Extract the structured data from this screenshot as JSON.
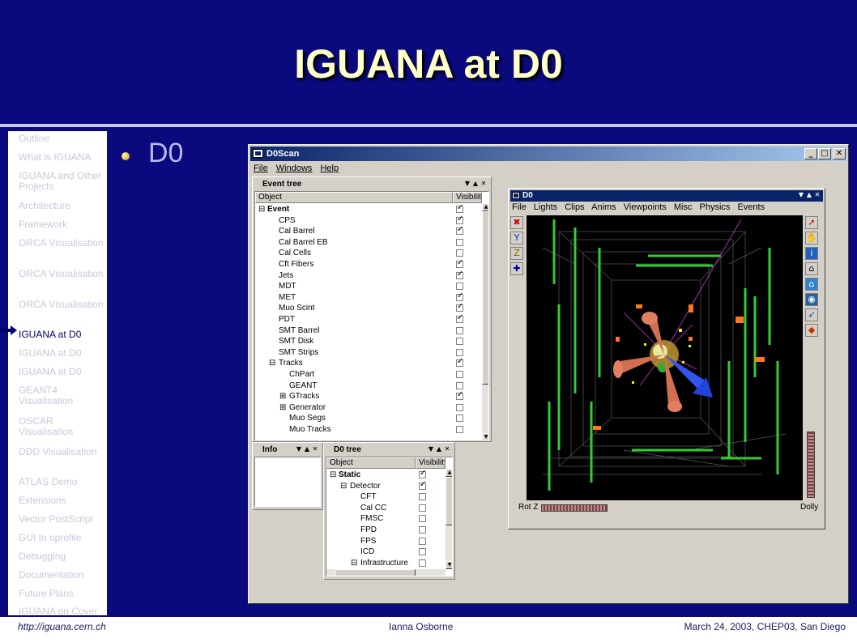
{
  "slide": {
    "title": "IGUANA at D0",
    "bullet": "D0"
  },
  "nav": {
    "items": [
      {
        "label": "Outline"
      },
      {
        "label": "What is IGUANA"
      },
      {
        "label": "IGUANA and Other Projects"
      },
      {
        "label": "Architecture"
      },
      {
        "label": "Framework"
      },
      {
        "label": "ORCA Visualisation"
      },
      {
        "label": "ORCA Visualisation"
      },
      {
        "label": "ORCA Visualisation"
      },
      {
        "label": "IGUANA at D0"
      },
      {
        "label": "IGUANA at D0"
      },
      {
        "label": "IGUANA at D0"
      },
      {
        "label": "GEANT4 Visualisation"
      },
      {
        "label": "OSCAR Visualisation"
      },
      {
        "label": "DDD Visualisation"
      },
      {
        "label": "ATLAS Demo"
      },
      {
        "label": "Extensions"
      },
      {
        "label": "Vector PostScript"
      },
      {
        "label": "GUI to oprofile"
      },
      {
        "label": "Debugging"
      },
      {
        "label": "Documentation"
      },
      {
        "label": "Future Plans"
      },
      {
        "label": "IGUANA on Cover"
      }
    ],
    "active_index": 8
  },
  "footer": {
    "url": "http://iguana.cern.ch",
    "author": "Ianna Osborne",
    "date": "March 24, 2003, CHEP03, San Diego"
  },
  "d0scan": {
    "title": "D0Scan",
    "menu": [
      "File",
      "Windows",
      "Help"
    ],
    "buttons": {
      "minimize": "_",
      "maximize": "□",
      "close": "✕"
    }
  },
  "event_tree": {
    "title": "Event tree",
    "col_object": "Object",
    "col_visibility": "Visibility",
    "rows": [
      {
        "label": "Event",
        "depth": 0,
        "expander": "⊟",
        "bold": true,
        "checked": true
      },
      {
        "label": "CPS",
        "depth": 1,
        "expander": "",
        "bold": false,
        "checked": true
      },
      {
        "label": "Cal Barrel",
        "depth": 1,
        "expander": "",
        "bold": false,
        "checked": true
      },
      {
        "label": "Cal Barrel EB",
        "depth": 1,
        "expander": "",
        "bold": false,
        "checked": false
      },
      {
        "label": "Cal Cells",
        "depth": 1,
        "expander": "",
        "bold": false,
        "checked": false
      },
      {
        "label": "Cft Fibers",
        "depth": 1,
        "expander": "",
        "bold": false,
        "checked": true
      },
      {
        "label": "Jets",
        "depth": 1,
        "expander": "",
        "bold": false,
        "checked": true
      },
      {
        "label": "MDT",
        "depth": 1,
        "expander": "",
        "bold": false,
        "checked": false
      },
      {
        "label": "MET",
        "depth": 1,
        "expander": "",
        "bold": false,
        "checked": true
      },
      {
        "label": "Muo Scint",
        "depth": 1,
        "expander": "",
        "bold": false,
        "checked": true
      },
      {
        "label": "PDT",
        "depth": 1,
        "expander": "",
        "bold": false,
        "checked": true
      },
      {
        "label": "SMT Barrel",
        "depth": 1,
        "expander": "",
        "bold": false,
        "checked": false
      },
      {
        "label": "SMT Disk",
        "depth": 1,
        "expander": "",
        "bold": false,
        "checked": false
      },
      {
        "label": "SMT Strips",
        "depth": 1,
        "expander": "",
        "bold": false,
        "checked": false
      },
      {
        "label": "Tracks",
        "depth": 1,
        "expander": "⊟",
        "bold": false,
        "checked": true
      },
      {
        "label": "ChPart",
        "depth": 2,
        "expander": "",
        "bold": false,
        "checked": false
      },
      {
        "label": "GEANT",
        "depth": 2,
        "expander": "",
        "bold": false,
        "checked": false
      },
      {
        "label": "GTracks",
        "depth": 2,
        "expander": "⊞",
        "bold": false,
        "checked": true
      },
      {
        "label": "Generator",
        "depth": 2,
        "expander": "⊞",
        "bold": false,
        "checked": false
      },
      {
        "label": "Muo Segs",
        "depth": 2,
        "expander": "",
        "bold": false,
        "checked": false
      },
      {
        "label": "Muo Tracks",
        "depth": 2,
        "expander": "",
        "bold": false,
        "checked": false
      }
    ]
  },
  "info_panel": {
    "title": "Info"
  },
  "d0_tree": {
    "title": "D0 tree",
    "col_object": "Object",
    "col_visibility": "Visibility",
    "rows": [
      {
        "label": "Static",
        "depth": 0,
        "expander": "⊟",
        "bold": true,
        "checked": true
      },
      {
        "label": "Detector",
        "depth": 1,
        "expander": "⊟",
        "bold": false,
        "checked": true
      },
      {
        "label": "CFT",
        "depth": 2,
        "expander": "",
        "bold": false,
        "checked": false
      },
      {
        "label": "Cal CC",
        "depth": 2,
        "expander": "",
        "bold": false,
        "checked": false
      },
      {
        "label": "FMSC",
        "depth": 2,
        "expander": "",
        "bold": false,
        "checked": false
      },
      {
        "label": "FPD",
        "depth": 2,
        "expander": "",
        "bold": false,
        "checked": false
      },
      {
        "label": "FPS",
        "depth": 2,
        "expander": "",
        "bold": false,
        "checked": false
      },
      {
        "label": "ICD",
        "depth": 2,
        "expander": "",
        "bold": false,
        "checked": false
      },
      {
        "label": "Infrastructure",
        "depth": 2,
        "expander": "⊟",
        "bold": false,
        "checked": false
      }
    ]
  },
  "viewer": {
    "title": "D0",
    "menu": [
      "File",
      "Lights",
      "Clips",
      "Anims",
      "Viewpoints",
      "Misc",
      "Physics",
      "Events"
    ],
    "left_tools": [
      "close-x-icon",
      "filter-icon",
      "z-axis-icon",
      "scale-icon"
    ],
    "right_tools": [
      "arrow-pointer-icon",
      "hand-icon",
      "info-icon",
      "home-icon",
      "set-home-icon",
      "view-all-icon",
      "seek-icon",
      "perspective-icon"
    ],
    "rot_z_label": "Rot Z",
    "dolly_label": "Dolly"
  },
  "colors": {
    "slide_blue": "#0a0a7e",
    "title_yellow": "#ffffc8",
    "win_title": "#0a246a",
    "track_green": "#33cc33"
  }
}
